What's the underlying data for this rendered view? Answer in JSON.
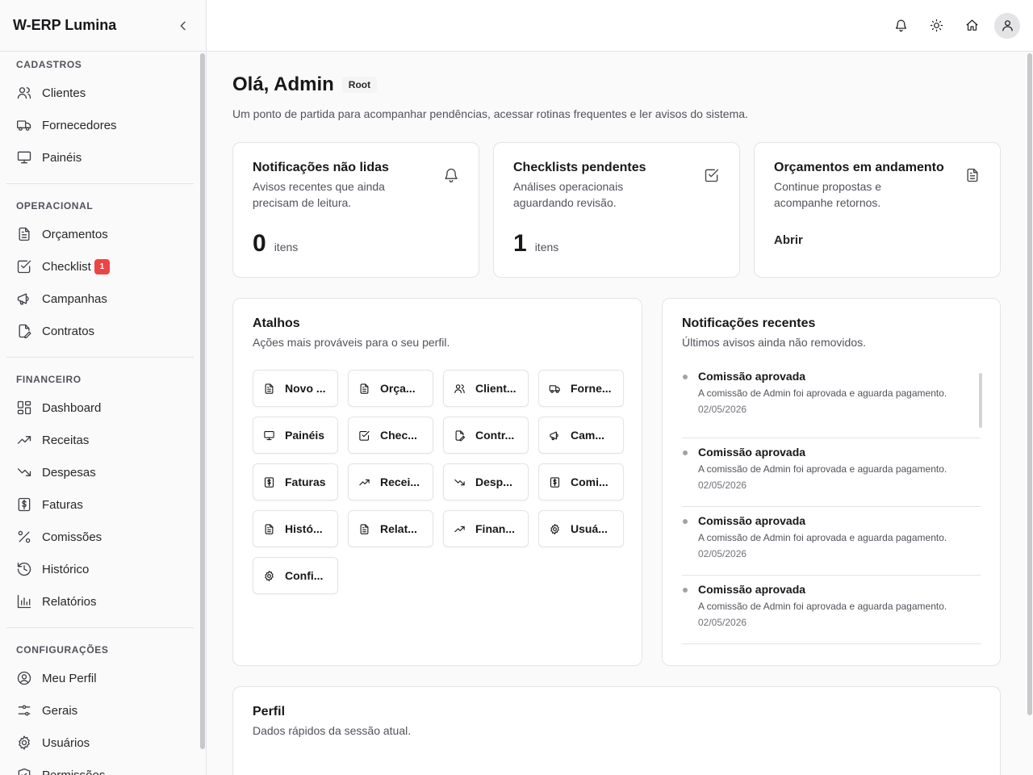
{
  "brand": {
    "name": "W-ERP Lumina"
  },
  "sidebar": {
    "sections": [
      {
        "title": "CADASTROS",
        "items": [
          {
            "label": "Clientes",
            "icon": "users-icon"
          },
          {
            "label": "Fornecedores",
            "icon": "truck-icon"
          },
          {
            "label": "Painéis",
            "icon": "monitor-icon"
          }
        ]
      },
      {
        "title": "OPERACIONAL",
        "items": [
          {
            "label": "Orçamentos",
            "icon": "file-text-icon"
          },
          {
            "label": "Checklist",
            "icon": "checkbox-icon",
            "badge": "1"
          },
          {
            "label": "Campanhas",
            "icon": "megaphone-icon"
          },
          {
            "label": "Contratos",
            "icon": "file-edit-icon"
          }
        ]
      },
      {
        "title": "FINANCEIRO",
        "items": [
          {
            "label": "Dashboard",
            "icon": "layout-dashboard-icon"
          },
          {
            "label": "Receitas",
            "icon": "trending-up-icon"
          },
          {
            "label": "Despesas",
            "icon": "trending-down-icon"
          },
          {
            "label": "Faturas",
            "icon": "receipt-icon"
          },
          {
            "label": "Comissões",
            "icon": "percent-icon"
          },
          {
            "label": "Histórico",
            "icon": "history-icon"
          },
          {
            "label": "Relatórios",
            "icon": "bar-chart-icon"
          }
        ]
      },
      {
        "title": "CONFIGURAÇÕES",
        "items": [
          {
            "label": "Meu Perfil",
            "icon": "user-circle-icon"
          },
          {
            "label": "Gerais",
            "icon": "sliders-icon"
          },
          {
            "label": "Usuários",
            "icon": "gear-icon"
          },
          {
            "label": "Permissões",
            "icon": "shield-icon"
          }
        ]
      }
    ]
  },
  "header": {
    "icons": [
      "bell-icon",
      "sun-icon",
      "home-icon",
      "user-icon"
    ]
  },
  "main": {
    "greeting": "Olá, Admin",
    "role": "Root",
    "subtitle": "Um ponto de partida para acompanhar pendências, acessar rotinas frequentes e ler avisos do sistema.",
    "stats": [
      {
        "title": "Notificações não lidas",
        "desc": "Avisos recentes que ainda precisam de leitura.",
        "value": "0",
        "unit": "itens",
        "icon": "bell-icon"
      },
      {
        "title": "Checklists pendentes",
        "desc": "Análises operacionais aguardando revisão.",
        "value": "1",
        "unit": "itens",
        "icon": "checkbox-icon"
      },
      {
        "title": "Orçamentos em andamento",
        "desc": "Continue propostas e acompanhe retornos.",
        "link": "Abrir",
        "icon": "file-text-icon"
      }
    ],
    "shortcuts": {
      "title": "Atalhos",
      "desc": "Ações mais prováveis para o seu perfil.",
      "items": [
        {
          "label": "Novo ...",
          "icon": "file-text-icon"
        },
        {
          "label": "Orça...",
          "icon": "file-text-icon"
        },
        {
          "label": "Client...",
          "icon": "users-icon"
        },
        {
          "label": "Forne...",
          "icon": "truck-icon"
        },
        {
          "label": "Painéis",
          "icon": "monitor-icon"
        },
        {
          "label": "Chec...",
          "icon": "checkbox-icon"
        },
        {
          "label": "Contr...",
          "icon": "file-edit-icon"
        },
        {
          "label": "Cam...",
          "icon": "megaphone-icon"
        },
        {
          "label": "Faturas",
          "icon": "receipt-icon"
        },
        {
          "label": "Recei...",
          "icon": "trending-up-icon"
        },
        {
          "label": "Desp...",
          "icon": "trending-down-icon"
        },
        {
          "label": "Comi...",
          "icon": "receipt-icon"
        },
        {
          "label": "Histó...",
          "icon": "file-text-icon"
        },
        {
          "label": "Relat...",
          "icon": "file-text-icon"
        },
        {
          "label": "Finan...",
          "icon": "trending-up-icon"
        },
        {
          "label": "Usuá...",
          "icon": "gear-icon"
        },
        {
          "label": "Confi...",
          "icon": "gear-icon"
        }
      ]
    },
    "notifications": {
      "title": "Notificações recentes",
      "desc": "Últimos avisos ainda não removidos.",
      "items": [
        {
          "title": "Comissão aprovada",
          "body": "A comissão de Admin foi aprovada e aguarda pagamento.",
          "date": "02/05/2026"
        },
        {
          "title": "Comissão aprovada",
          "body": "A comissão de Admin foi aprovada e aguarda pagamento.",
          "date": "02/05/2026"
        },
        {
          "title": "Comissão aprovada",
          "body": "A comissão de Admin foi aprovada e aguarda pagamento.",
          "date": "02/05/2026"
        },
        {
          "title": "Comissão aprovada",
          "body": "A comissão de Admin foi aprovada e aguarda pagamento.",
          "date": "02/05/2026"
        }
      ]
    },
    "profile": {
      "title": "Perfil",
      "desc": "Dados rápidos da sessão atual."
    }
  }
}
